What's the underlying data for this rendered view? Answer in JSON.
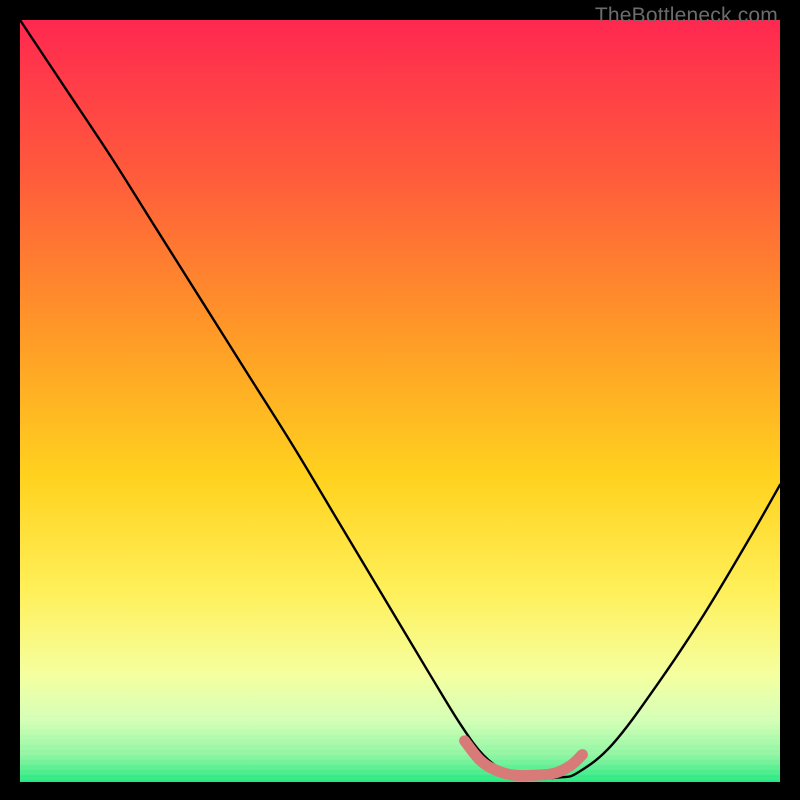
{
  "watermark": "TheBottleneck.com",
  "chart_data": {
    "type": "line",
    "title": "",
    "xlabel": "",
    "ylabel": "",
    "xlim": [
      0,
      100
    ],
    "ylim": [
      0,
      100
    ],
    "legend": false,
    "grid": false,
    "background_gradient": {
      "stops": [
        {
          "offset": 0.0,
          "color": "#ff2850"
        },
        {
          "offset": 0.2,
          "color": "#ff5a3c"
        },
        {
          "offset": 0.4,
          "color": "#ff9628"
        },
        {
          "offset": 0.6,
          "color": "#ffd21e"
        },
        {
          "offset": 0.75,
          "color": "#fff05a"
        },
        {
          "offset": 0.86,
          "color": "#f5ffa0"
        },
        {
          "offset": 0.92,
          "color": "#d2ffb4"
        },
        {
          "offset": 0.965,
          "color": "#8cf5a0"
        },
        {
          "offset": 1.0,
          "color": "#20e87e"
        }
      ]
    },
    "series": [
      {
        "name": "bottleneck-curve",
        "color": "#000000",
        "x": [
          0.0,
          6.0,
          12.0,
          18.0,
          24.0,
          30.0,
          36.0,
          42.0,
          48.0,
          54.0,
          58.0,
          61.0,
          64.0,
          67.0,
          71.0,
          73.5,
          78.0,
          84.0,
          90.0,
          96.0,
          100.0
        ],
        "y": [
          100.0,
          91.0,
          82.0,
          72.5,
          63.0,
          53.5,
          44.0,
          34.0,
          24.0,
          14.0,
          7.5,
          3.5,
          1.3,
          0.6,
          0.6,
          1.3,
          5.0,
          13.0,
          22.0,
          32.0,
          39.0
        ]
      },
      {
        "name": "optimal-band-marker",
        "color": "#d87a78",
        "x": [
          58.5,
          60.5,
          62.5,
          65.0,
          68.0,
          70.5,
          72.5,
          74.0
        ],
        "y": [
          5.4,
          2.9,
          1.6,
          0.9,
          0.9,
          1.2,
          2.2,
          3.6
        ]
      }
    ]
  }
}
